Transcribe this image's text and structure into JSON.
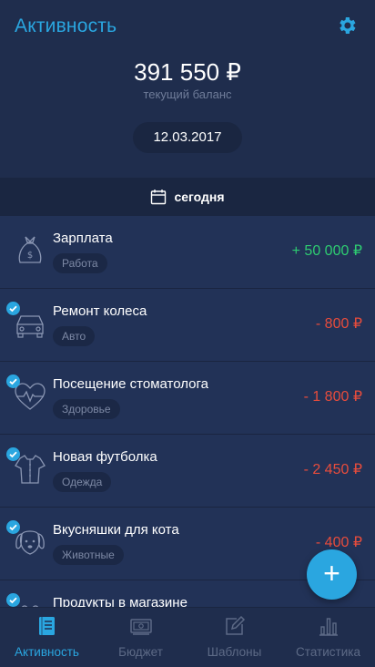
{
  "header": {
    "title": "Активность",
    "balance": "391 550 ₽",
    "balance_label": "текущий баланс",
    "date": "12.03.2017"
  },
  "day_bar": {
    "label": "сегодня",
    "icon": "calendar-icon"
  },
  "transactions": [
    {
      "name": "Зарплата",
      "category": "Работа",
      "amount": "+ 50 000 ₽",
      "type": "income",
      "icon": "money-bag-icon",
      "checked": false
    },
    {
      "name": "Ремонт колеса",
      "category": "Авто",
      "amount": "- 800 ₽",
      "type": "expense",
      "icon": "car-icon",
      "checked": true
    },
    {
      "name": "Посещение стоматолога",
      "category": "Здоровье",
      "amount": "- 1 800 ₽",
      "type": "expense",
      "icon": "heart-pulse-icon",
      "checked": true
    },
    {
      "name": "Новая футболка",
      "category": "Одежда",
      "amount": "- 2 450 ₽",
      "type": "expense",
      "icon": "shirt-icon",
      "checked": true
    },
    {
      "name": "Вкусняшки для кота",
      "category": "Животные",
      "amount": "- 400 ₽",
      "type": "expense",
      "icon": "pet-icon",
      "checked": true
    },
    {
      "name": "Продукты в магазине",
      "category": "",
      "amount": "",
      "type": "expense",
      "icon": "cart-icon",
      "checked": true
    }
  ],
  "fab": {
    "label": "+"
  },
  "bottom_nav": [
    {
      "label": "Активность",
      "icon": "activity-list-icon",
      "active": true
    },
    {
      "label": "Бюджет",
      "icon": "budget-money-icon",
      "active": false
    },
    {
      "label": "Шаблоны",
      "icon": "templates-edit-icon",
      "active": false
    },
    {
      "label": "Статистика",
      "icon": "statistics-chart-icon",
      "active": false
    }
  ],
  "colors": {
    "accent": "#2aa6e0",
    "background": "#1f2d4d",
    "income": "#2ecc71",
    "expense": "#e74c3c",
    "muted": "#6f7c99"
  }
}
